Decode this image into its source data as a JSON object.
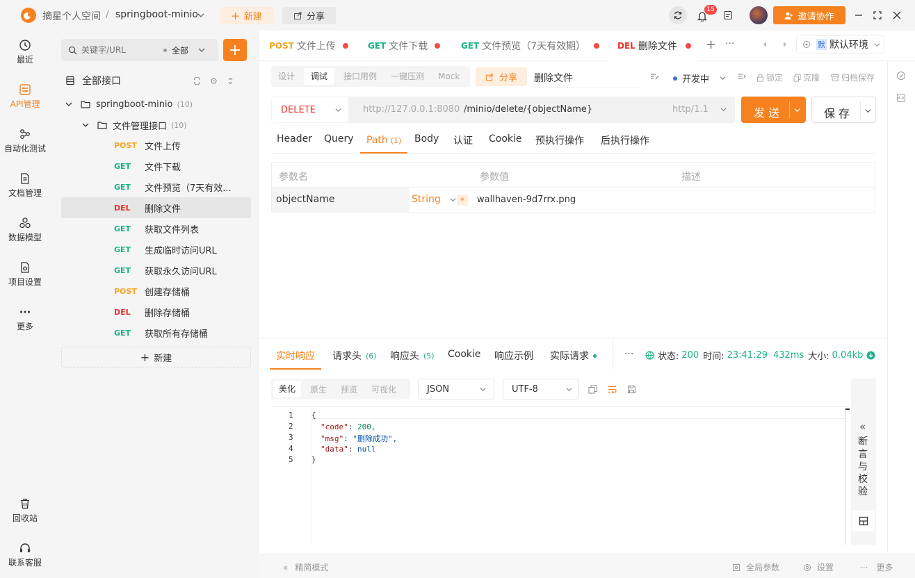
{
  "topbar": {
    "workspace": "摘星个人空间",
    "separator": "/",
    "project": "springboot-minio",
    "new_label": "新建",
    "share_label": "分享",
    "notification_count": "15",
    "invite_label": "邀请协作"
  },
  "rail": [
    {
      "label": "最近",
      "icon": "history-icon"
    },
    {
      "label": "API管理",
      "icon": "api-icon"
    },
    {
      "label": "自动化测试",
      "icon": "automation-icon"
    },
    {
      "label": "文档管理",
      "icon": "document-icon"
    },
    {
      "label": "数据模型",
      "icon": "data-model-icon"
    },
    {
      "label": "项目设置",
      "icon": "project-settings-icon"
    },
    {
      "label": "更多",
      "icon": "more-icon"
    },
    {
      "label": "回收站",
      "icon": "trash-icon"
    },
    {
      "label": "联系客服",
      "icon": "headset-icon"
    }
  ],
  "sidebar": {
    "search_placeholder": "关键字/URL",
    "filter": "全部",
    "root_label": "全部接口",
    "project_node": "springboot-minio",
    "project_count": "(10)",
    "folder_node": "文件管理接口",
    "folder_count": "(10)",
    "items": [
      {
        "method": "POST",
        "name": "文件上传"
      },
      {
        "method": "GET",
        "name": "文件下载"
      },
      {
        "method": "GET",
        "name": "文件预览（7天有效..."
      },
      {
        "method": "DEL",
        "name": "删除文件"
      },
      {
        "method": "GET",
        "name": "获取文件列表"
      },
      {
        "method": "GET",
        "name": "生成临时访问URL"
      },
      {
        "method": "GET",
        "name": "获取永久访问URL"
      },
      {
        "method": "POST",
        "name": "创建存储桶"
      },
      {
        "method": "DEL",
        "name": "删除存储桶"
      },
      {
        "method": "GET",
        "name": "获取所有存储桶"
      }
    ],
    "new_label": "新建"
  },
  "tabs": [
    {
      "method": "POST",
      "name": "文件上传"
    },
    {
      "method": "GET",
      "name": "文件下载"
    },
    {
      "method": "GET",
      "name": "文件预览（7天有效期）"
    },
    {
      "method": "DEL",
      "name": "删除文件"
    }
  ],
  "env": {
    "badge": "默",
    "label": "默认环境"
  },
  "mode_tabs": [
    "设计",
    "调试",
    "接口用例",
    "一键压测",
    "Mock"
  ],
  "toolbar": {
    "share_label": "分享",
    "api_name": "删除文件",
    "status": "开发中",
    "lock": "锁定",
    "clone": "克隆",
    "archive": "归档保存"
  },
  "request": {
    "method": "DELETE",
    "base_url": "http://127.0.0.1:8080",
    "path": "/minio/delete/{objectName}",
    "protocol": "http/1.1",
    "send_label": "发 送",
    "save_label": "保 存"
  },
  "param_tabs": [
    {
      "label": "Header"
    },
    {
      "label": "Query"
    },
    {
      "label": "Path",
      "count": "(1)"
    },
    {
      "label": "Body"
    },
    {
      "label": "认证"
    },
    {
      "label": "Cookie"
    },
    {
      "label": "预执行操作"
    },
    {
      "label": "后执行操作"
    }
  ],
  "params_table": {
    "headers": [
      "参数名",
      "参数值",
      "描述"
    ],
    "row": {
      "name": "objectName",
      "type": "String",
      "required": "*",
      "value": "wallhaven-9d7rrx.png"
    }
  },
  "response_tabs": [
    {
      "label": "实时响应"
    },
    {
      "label": "请求头",
      "count": "(6)"
    },
    {
      "label": "响应头",
      "count": "(5)"
    },
    {
      "label": "Cookie"
    },
    {
      "label": "响应示例"
    },
    {
      "label": "实际请求"
    }
  ],
  "response_status": {
    "status_label": "状态:",
    "status": "200",
    "time_label": "时间:",
    "time": "23:41:29",
    "duration": "432ms",
    "size_label": "大小:",
    "size": "0.04kb",
    "more": "···"
  },
  "view_tabs": [
    "美化",
    "原生",
    "预览",
    "可视化"
  ],
  "format_select": "JSON",
  "encoding_select": "UTF-8",
  "code_lines": [
    {
      "n": "1",
      "text": "{"
    },
    {
      "n": "2",
      "key": "\"code\"",
      "val": " 200,"
    },
    {
      "n": "3",
      "key": "\"msg\"",
      "val": " \"删除成功\","
    },
    {
      "n": "4",
      "key": "\"data\"",
      "val": " null"
    },
    {
      "n": "5",
      "text": "}"
    }
  ],
  "assert_panel": {
    "chevron": "«",
    "label": "断言与校验"
  },
  "footer": {
    "compact": "精简模式",
    "global_params": "全局参数",
    "settings": "设置",
    "more": "更多"
  },
  "colors": {
    "accent": "#f5821f",
    "get": "#1bb287",
    "post": "#f5a623",
    "del": "#e5332a"
  }
}
